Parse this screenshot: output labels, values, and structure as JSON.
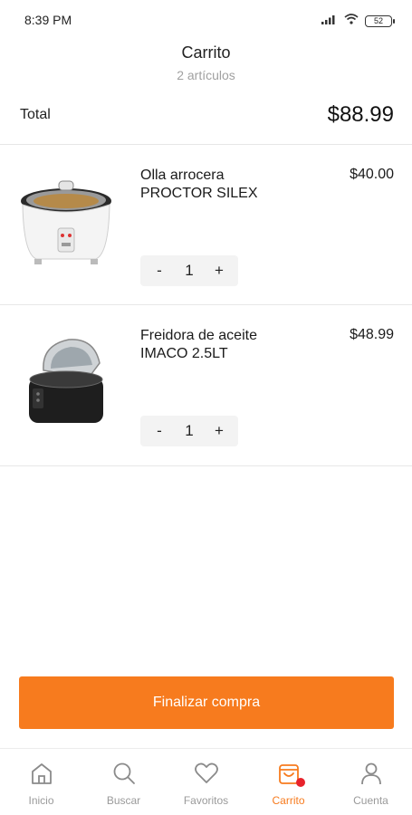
{
  "status_bar": {
    "time": "8:39 PM",
    "battery": "52"
  },
  "header": {
    "title": "Carrito",
    "subtitle": "2 artículos"
  },
  "summary": {
    "total_label": "Total",
    "total_value": "$88.99"
  },
  "items": [
    {
      "name": "Olla arrocera\nPROCTOR SILEX",
      "price": "$40.00",
      "quantity": "1",
      "decrement_label": "-",
      "increment_label": "+"
    },
    {
      "name": "Freidora de aceite\nIMACO 2.5LT",
      "price": "$48.99",
      "quantity": "1",
      "decrement_label": "-",
      "increment_label": "+"
    }
  ],
  "checkout": {
    "label": "Finalizar compra"
  },
  "nav": {
    "items": [
      {
        "label": "Inicio",
        "icon": "home-icon"
      },
      {
        "label": "Buscar",
        "icon": "search-icon"
      },
      {
        "label": "Favoritos",
        "icon": "heart-icon"
      },
      {
        "label": "Carrito",
        "icon": "cart-icon",
        "active": true
      },
      {
        "label": "Cuenta",
        "icon": "user-icon"
      }
    ]
  },
  "colors": {
    "accent": "#f77b1e",
    "badge": "#e8232b",
    "muted": "#9a9a9a"
  }
}
